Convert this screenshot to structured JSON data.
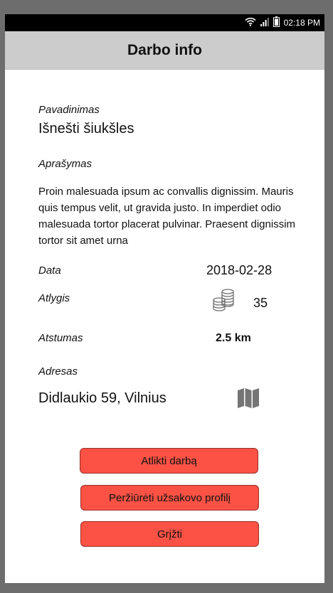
{
  "status": {
    "time": "02:18 PM",
    "wifi_icon": "wifi-icon",
    "signal_icon": "signal-icon",
    "battery_icon": "battery-icon"
  },
  "header": {
    "title": "Darbo info"
  },
  "job": {
    "name_label": "Pavadinimas",
    "name": "Išnešti šiukšles",
    "desc_label": "Aprašymas",
    "description": "Proin malesuada ipsum ac convallis dignissim. Mauris quis tempus velit, ut gravida justo. In imperdiet odio malesuada tortor placerat pulvinar. Praesent dignissim tortor sit amet urna",
    "date_label": "Data",
    "date": "2018-02-28",
    "reward_label": "Atlygis",
    "reward_icon": "coins-icon",
    "reward": "35",
    "distance_label": "Atstumas",
    "distance": "2.5 km",
    "address_label": "Adresas",
    "address": "Didlaukio 59, Vilnius",
    "map_icon": "map-icon"
  },
  "actions": {
    "accept_label": "Atlikti darbą",
    "profile_label": "Peržiūrėti užsakovo profilį",
    "back_label": "Grįžti"
  },
  "colors": {
    "button": "#fb5245",
    "header": "#cccccc",
    "frame": "#6d6d6d"
  }
}
